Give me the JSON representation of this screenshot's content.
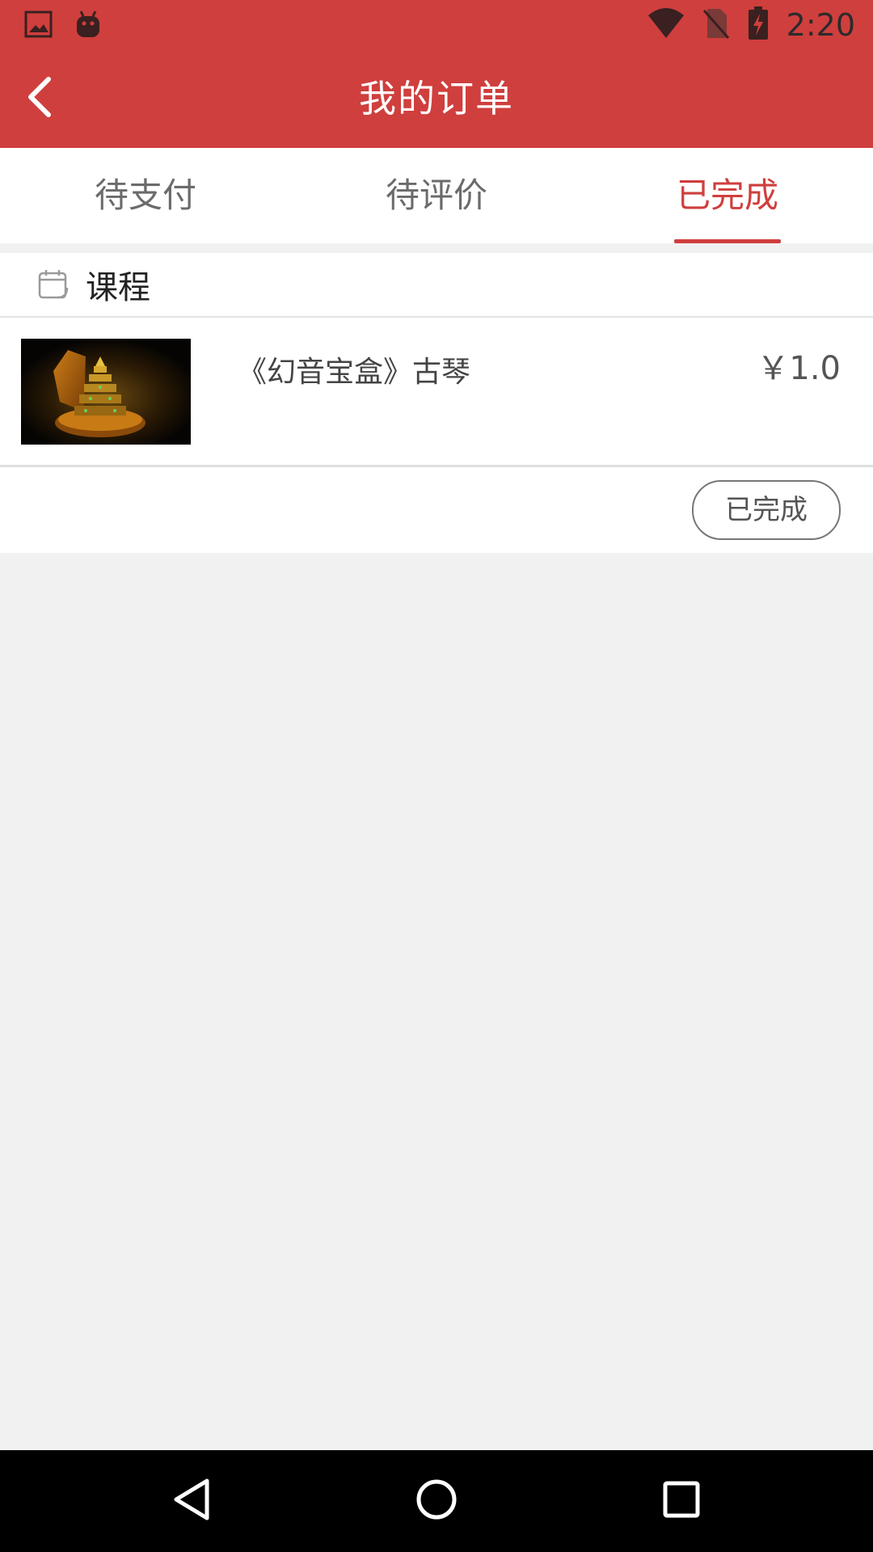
{
  "status_bar": {
    "time": "2:20",
    "left_icons": [
      "image-icon",
      "android-icon"
    ],
    "right_icons": [
      "wifi-icon",
      "no-sim-icon",
      "battery-charging-icon"
    ]
  },
  "header": {
    "title": "我的订单",
    "back_icon": "chevron-left-icon",
    "background_color": "#cf3f3d"
  },
  "tabs": [
    {
      "label": "待支付",
      "active": false
    },
    {
      "label": "待评价",
      "active": false
    },
    {
      "label": "已完成",
      "active": true
    }
  ],
  "accent_color": "#cf3f3d",
  "order": {
    "section_icon": "calendar-icon",
    "section_title": "课程",
    "product": {
      "name": "《幻音宝盒》古琴",
      "price": "￥1.0"
    },
    "status_button": "已完成"
  },
  "nav_bar": {
    "buttons": [
      "back-triangle-icon",
      "home-circle-icon",
      "recents-square-icon"
    ]
  }
}
